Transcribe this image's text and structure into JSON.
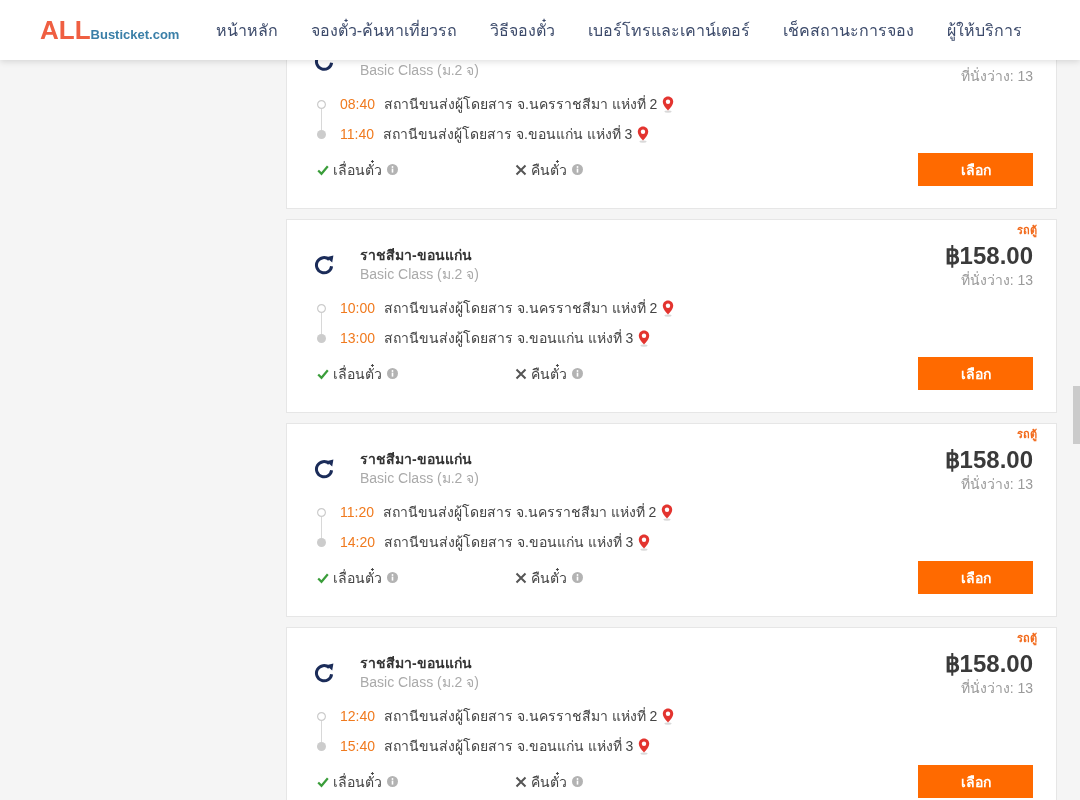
{
  "header": {
    "logo": {
      "brand": "ALL",
      "domain": "Busticket.com"
    },
    "nav": [
      "หน้าหลัก",
      "จองตั๋ว-ค้นหาเที่ยวรถ",
      "วิธีจองตั๋ว",
      "เบอร์โทรและเคาน์เตอร์",
      "เช็คสถานะการจอง",
      "ผู้ให้บริการ"
    ]
  },
  "trips": [
    {
      "bus_class": "Basic Class (ม.2 จ)",
      "seats": "ที่นั่งว่าง: 13",
      "stops": [
        {
          "kind": "departure",
          "time": "08:40",
          "station": "สถานีขนส่งผู้โดยสาร จ.นครราชสีมา แห่งที่ 2"
        },
        {
          "kind": "arrival",
          "time": "11:40",
          "station": "สถานีขนส่งผู้โดยสาร จ.ขอนแก่น แห่งที่ 3"
        }
      ],
      "policies": [
        {
          "label": "เลื่อนตั๋ว",
          "allowed": true
        },
        {
          "label": "คืนตั๋ว",
          "allowed": false
        }
      ],
      "select_button": "เลือก"
    },
    {
      "vehicle_type": "รถตู้",
      "route": "ราชสีมา-ขอนแก่น",
      "bus_class": "Basic Class (ม.2 จ)",
      "price": "฿158.00",
      "seats": "ที่นั่งว่าง: 13",
      "stops": [
        {
          "kind": "departure",
          "time": "10:00",
          "station": "สถานีขนส่งผู้โดยสาร จ.นครราชสีมา แห่งที่ 2"
        },
        {
          "kind": "arrival",
          "time": "13:00",
          "station": "สถานีขนส่งผู้โดยสาร จ.ขอนแก่น แห่งที่ 3"
        }
      ],
      "policies": [
        {
          "label": "เลื่อนตั๋ว",
          "allowed": true
        },
        {
          "label": "คืนตั๋ว",
          "allowed": false
        }
      ],
      "select_button": "เลือก"
    },
    {
      "vehicle_type": "รถตู้",
      "route": "ราชสีมา-ขอนแก่น",
      "bus_class": "Basic Class (ม.2 จ)",
      "price": "฿158.00",
      "seats": "ที่นั่งว่าง: 13",
      "stops": [
        {
          "kind": "departure",
          "time": "11:20",
          "station": "สถานีขนส่งผู้โดยสาร จ.นครราชสีมา แห่งที่ 2"
        },
        {
          "kind": "arrival",
          "time": "14:20",
          "station": "สถานีขนส่งผู้โดยสาร จ.ขอนแก่น แห่งที่ 3"
        }
      ],
      "policies": [
        {
          "label": "เลื่อนตั๋ว",
          "allowed": true
        },
        {
          "label": "คืนตั๋ว",
          "allowed": false
        }
      ],
      "select_button": "เลือก"
    },
    {
      "vehicle_type": "รถตู้",
      "route": "ราชสีมา-ขอนแก่น",
      "bus_class": "Basic Class (ม.2 จ)",
      "price": "฿158.00",
      "seats": "ที่นั่งว่าง: 13",
      "stops": [
        {
          "kind": "departure",
          "time": "12:40",
          "station": "สถานีขนส่งผู้โดยสาร จ.นครราชสีมา แห่งที่ 2"
        },
        {
          "kind": "arrival",
          "time": "15:40",
          "station": "สถานีขนส่งผู้โดยสาร จ.ขอนแก่น แห่งที่ 3"
        }
      ],
      "policies": [
        {
          "label": "เลื่อนตั๋ว",
          "allowed": true
        },
        {
          "label": "คืนตั๋ว",
          "allowed": false
        }
      ],
      "select_button": "เลือก"
    }
  ]
}
